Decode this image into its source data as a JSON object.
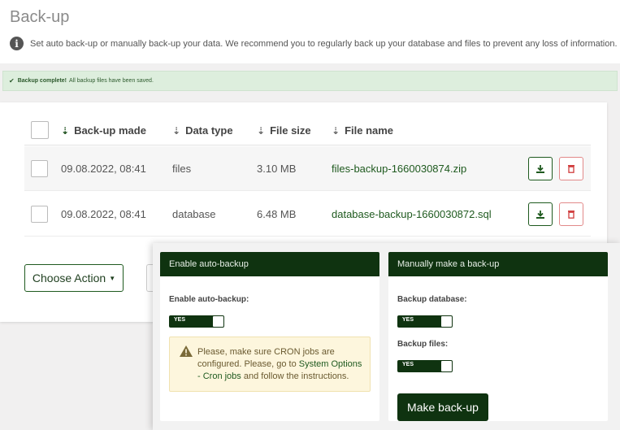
{
  "page": {
    "title": "Back-up",
    "info": "Set auto back-up or manually back-up your data. We recommend you to regularly back up your database and files to prevent any loss of information."
  },
  "alert": {
    "bold": "Backup complete!",
    "text": "All backup files have been saved."
  },
  "table": {
    "columns": [
      "Back-up made",
      "Data type",
      "File size",
      "File name"
    ],
    "rows": [
      {
        "date": "09.08.2022, 08:41",
        "type": "files",
        "size": "3.10 MB",
        "name": "files-backup-1660030874.zip"
      },
      {
        "date": "09.08.2022, 08:41",
        "type": "database",
        "size": "6.48 MB",
        "name": "database-backup-1660030872.sql"
      }
    ]
  },
  "actions": {
    "choose_label": "Choose Action"
  },
  "auto_backup": {
    "header": "Enable auto-backup",
    "label": "Enable auto-backup:",
    "toggle": "YES",
    "warning_pre": "Please, make sure CRON jobs are configured. Please, go to ",
    "warning_link": "System Options - Cron jobs",
    "warning_post": " and follow the instructions."
  },
  "manual_backup": {
    "header": "Manually make a back-up",
    "db_label": "Backup database:",
    "db_toggle": "YES",
    "files_label": "Backup files:",
    "files_toggle": "YES",
    "button": "Make back-up"
  },
  "colors": {
    "primary": "#0f3310",
    "link": "#1f5a1f",
    "danger": "#d03b3b",
    "alert_bg": "#ddeedd",
    "warning_bg": "#fdf6dd"
  }
}
